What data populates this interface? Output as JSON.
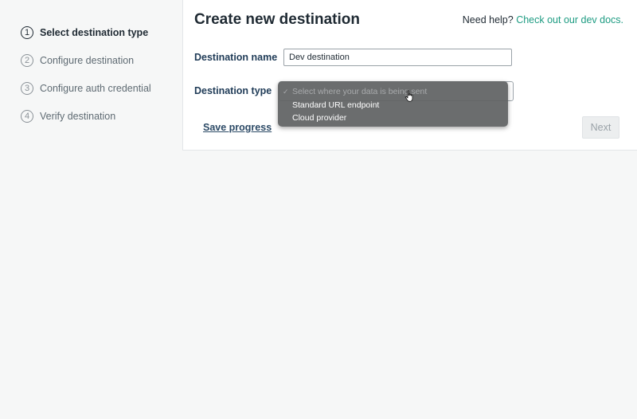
{
  "steps": [
    {
      "num": "1",
      "label": "Select destination type",
      "active": true
    },
    {
      "num": "2",
      "label": "Configure destination",
      "active": false
    },
    {
      "num": "3",
      "label": "Configure auth credential",
      "active": false
    },
    {
      "num": "4",
      "label": "Verify destination",
      "active": false
    }
  ],
  "header": {
    "title": "Create new destination",
    "help_text": "Need help?",
    "help_link": "Check out our dev docs."
  },
  "form": {
    "name_label": "Destination name",
    "name_value": "Dev destination",
    "type_label": "Destination type",
    "type_placeholder": "Select where your data is being sent",
    "type_options": [
      "Standard URL endpoint",
      "Cloud provider"
    ]
  },
  "actions": {
    "save_label": "Save progress",
    "next_label": "Next"
  },
  "colors": {
    "link": "#1f9c83",
    "label": "#1f3b57",
    "menu_bg": "#606263"
  }
}
